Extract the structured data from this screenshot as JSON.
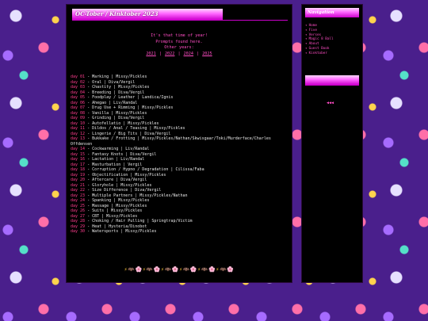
{
  "main": {
    "title": "OC-Tober / Kinktober 2023",
    "intro_lines": [
      "It's that time of year!",
      "Prompts found here."
    ],
    "other_years_label": "Other years:",
    "years": [
      "2021",
      "2022",
      "2024",
      "2025"
    ],
    "days": [
      {
        "day": "day 01",
        "text": " - Marking | Missy/Pickles"
      },
      {
        "day": "day 02",
        "text": " - Oral | Diva/Vergil"
      },
      {
        "day": "day 03",
        "text": " - Chastity | Missy/Pickles"
      },
      {
        "day": "day 04",
        "text": " - Breeding | Diva/Vergil"
      },
      {
        "day": "day 05",
        "text": " - Foodplay / Leather | Landica/Ignis"
      },
      {
        "day": "day 06",
        "text": " - Ahegao | Liv/Randal"
      },
      {
        "day": "day 07",
        "text": " - Drug Use + Rimming | Missy/Pickles"
      },
      {
        "day": "day 08",
        "text": " - Vanilla | Missy/Pickles"
      },
      {
        "day": "day 09",
        "text": " - Grinding | Diva/Vergil"
      },
      {
        "day": "day 10",
        "text": " - Autofellatio | Missy/Pickles"
      },
      {
        "day": "day 11",
        "text": " - Dildos / Anal / Teasing | Missy/Pickles"
      },
      {
        "day": "day 12",
        "text": " - Lingerie / Big Tits | Diva/Vergil"
      },
      {
        "day": "day 13",
        "text": " - Bukkake / Frotting | Missy/Pickles/Nathan/Skwisgaar/Toki/Murderface/Charles Offdensen"
      },
      {
        "day": "day 14",
        "text": " - Cockwarming | Liv/Randal"
      },
      {
        "day": "day 15",
        "text": " - Fantasy Knots | Diva/Vergil"
      },
      {
        "day": "day 16",
        "text": " - Lactation | Liv/Randal"
      },
      {
        "day": "day 17",
        "text": " - Masturbation | Vergil"
      },
      {
        "day": "day 18",
        "text": " - Corruption / Hypno / Degradation | Cilissa/Faba"
      },
      {
        "day": "day 19",
        "text": " - Objectification | Missy/Pickles"
      },
      {
        "day": "day 20",
        "text": " - Aftercare | Diva/Vergil"
      },
      {
        "day": "day 21",
        "text": " - Gloryhole | Missy/Pickles"
      },
      {
        "day": "day 22",
        "text": " - Size Difference | Diva/Vergil"
      },
      {
        "day": "day 23",
        "text": " - Multiple Partners | Missy/Pickles/Nathan"
      },
      {
        "day": "day 24",
        "text": " - Spanking | Missy/Pickles"
      },
      {
        "day": "day 25",
        "text": " - Massage | Missy/Pickles"
      },
      {
        "day": "day 26",
        "text": " - Suits | Missy/Pickles"
      },
      {
        "day": "day 27",
        "text": " - CBT | Missy/Pickles"
      },
      {
        "day": "day 28",
        "text": " - Choking / Hair Pulling | Springtrap/Victim"
      },
      {
        "day": "day 29",
        "text": " - Heat | Hysteria/Dinobot"
      },
      {
        "day": "day 30",
        "text": " - Watersports | Missy/Pickles"
      }
    ],
    "emoji_row": "⚡🦇🌸⚡🦇🌸⚡🦇🌸⚡🦇🌸⚡🦇🌸⚡🦇🌸"
  },
  "nav": {
    "title": "Navigation",
    "bullet": "✦",
    "items": [
      "Home",
      "Five",
      "Verses",
      "Magic 8 Ball",
      "About",
      "Guest Book",
      "Kinktober"
    ],
    "prev_arrows": "◀◀◀"
  }
}
